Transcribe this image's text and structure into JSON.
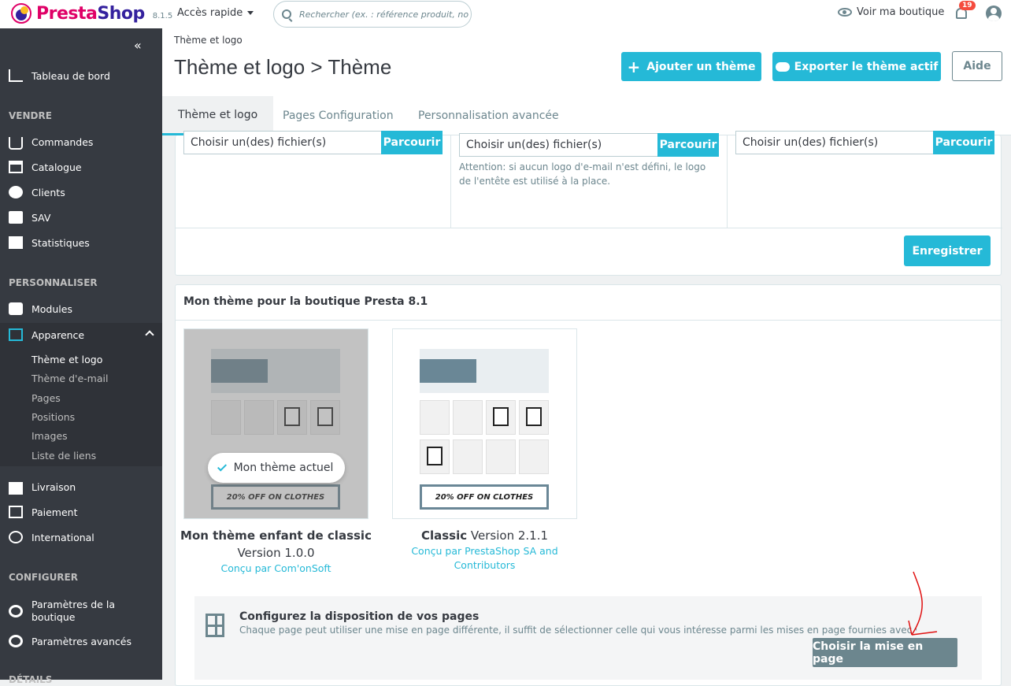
{
  "topbar": {
    "brand_main": "Presta",
    "brand_accent": "Shop",
    "version": "8.1.5",
    "quick_access": "Accès rapide",
    "search_placeholder": "Rechercher (ex. : référence produit, no",
    "view_shop": "Voir ma boutique",
    "notifications_count": "19"
  },
  "sidebar": {
    "collapse_glyph": "«",
    "items": [
      {
        "label": "Tableau de bord"
      },
      {
        "label": "Commandes"
      },
      {
        "label": "Catalogue"
      },
      {
        "label": "Clients"
      },
      {
        "label": "SAV"
      },
      {
        "label": "Statistiques"
      },
      {
        "label": "Modules"
      },
      {
        "label": "Apparence"
      },
      {
        "label": "Livraison"
      },
      {
        "label": "Paiement"
      },
      {
        "label": "International"
      },
      {
        "label": "Paramètres de la boutique"
      },
      {
        "label": "Paramètres avancés"
      }
    ],
    "sections": [
      "VENDRE",
      "PERSONNALISER",
      "CONFIGURER",
      "DÉTAILS"
    ],
    "apparence_sub": [
      "Thème et logo",
      "Thème d'e-mail",
      "Pages",
      "Positions",
      "Images",
      "Liste de liens"
    ]
  },
  "header": {
    "breadcrumb": "Thème et logo",
    "title": "Thème et logo > Thème",
    "add_theme": "Ajouter un thème",
    "export_theme": "Exporter le thème actif",
    "help": "Aide"
  },
  "tabs": [
    "Thème et logo",
    "Pages Configuration",
    "Personnalisation avancée"
  ],
  "logo_panel": {
    "file_placeholder": "Choisir un(des) fichier(s)",
    "browse": "Parcourir",
    "email_note": "Attention: si aucun logo d'e-mail n'est défini, le logo de l'entête est utilisé à la place.",
    "save": "Enregistrer"
  },
  "themes_panel": {
    "heading": "Mon thème pour la boutique Presta 8.1",
    "current_badge": "Mon thème actuel",
    "promo": "20% OFF ON CLOTHES",
    "themes": [
      {
        "name": "Mon thème enfant de classic",
        "version": "Version 1.0.0",
        "author": "Conçu par Com'onSoft"
      },
      {
        "name": "Classic",
        "version": "Version 2.1.1",
        "author": "Conçu par PrestaShop SA and Contributors"
      }
    ]
  },
  "layout_box": {
    "title": "Configurez la disposition de vos pages",
    "text": "Chaque page peut utiliser une mise en page différente, il suffit de sélectionner celle qui vous intéresse parmi les mises en page fournies avec votre thème.",
    "button": "Choisir la mise en page"
  },
  "colors": {
    "accent": "#25b9d7",
    "sidebar": "#363a41",
    "brand": "#df0067"
  }
}
